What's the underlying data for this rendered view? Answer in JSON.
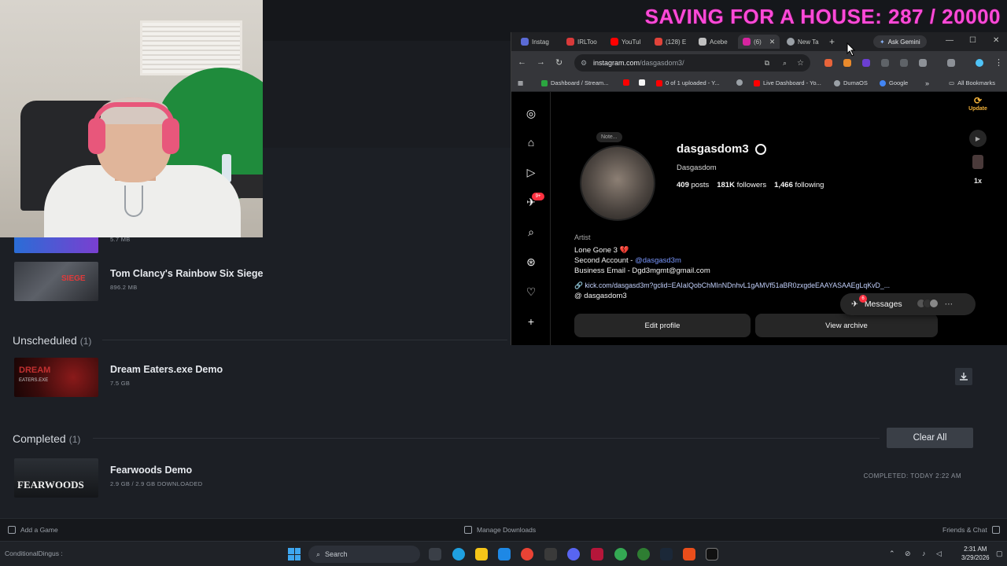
{
  "overlay": {
    "saving_text": "SAVING FOR A HOUSE: 287 / 20000"
  },
  "steam": {
    "games_top": [
      {
        "title": "",
        "size": "5.7 MB"
      },
      {
        "title": "Tom Clancy's Rainbow Six Siege",
        "size": "896.2 MB",
        "thumb_text": "SIEGE"
      }
    ],
    "unscheduled": {
      "label": "Unscheduled",
      "count": "(1)"
    },
    "unscheduled_game": {
      "title": "Dream Eaters.exe Demo",
      "size": "7.5 GB",
      "thumb_text": "DREAM",
      "thumb_sub": "EATERS.EXE"
    },
    "completed": {
      "label": "Completed",
      "count": "(1)"
    },
    "completed_game": {
      "title": "Fearwoods Demo",
      "size": "2.9 GB / 2.9 GB DOWNLOADED",
      "thumb_text": "FEARWOODS",
      "completed_at": "COMPLETED: TODAY 2:22 AM"
    },
    "clear_all": "Clear All",
    "footer": {
      "add_game": "Add a Game",
      "manage_downloads": "Manage Downloads",
      "friends_chat": "Friends & Chat"
    }
  },
  "chrome": {
    "tabs": [
      {
        "label": "Instag",
        "color": "#5b6bd6"
      },
      {
        "label": "IRLToo",
        "color": "#d93a3a"
      },
      {
        "label": "YouTul",
        "color": "#ff0000"
      },
      {
        "label": "(128) E",
        "color": "#e0433a"
      },
      {
        "label": "Acebe",
        "color": "#c0c0c0"
      },
      {
        "label": "(6)",
        "color": "#d6249f",
        "active": true
      },
      {
        "label": "New Ta",
        "color": "#9aa0a6"
      }
    ],
    "new_tab_symbol": "+",
    "ask_gemini": "Ask Gemini",
    "url_domain": "instagram.com",
    "url_path": "/dasgasdom3/",
    "bookmarks": [
      {
        "label": "Dashboard / Stream...",
        "color": "#2ba640"
      },
      {
        "label": "",
        "color": "#ff0000"
      },
      {
        "label": "",
        "color": "#f5f5f5"
      },
      {
        "label": "0 of 1 uploaded - Y...",
        "color": "#ff0000"
      },
      {
        "label": "",
        "color": "#9aa0a6"
      },
      {
        "label": "Live Dashboard - Yo...",
        "color": "#ff0000"
      },
      {
        "label": "DumaOS",
        "color": "#9aa0a6"
      },
      {
        "label": "Google",
        "color": "#4285f4"
      }
    ],
    "all_bookmarks": "All Bookmarks",
    "more_bookmarks": "»"
  },
  "instagram": {
    "note_text": "Note...",
    "username": "dasgasdom3",
    "full_name": "Dasgasdom",
    "posts_count": "409",
    "posts_label": "posts",
    "followers_count": "181K",
    "followers_label": "followers",
    "following_count": "1,466",
    "following_label": "following",
    "category": "Artist",
    "bio_line1": "Lone Gone 3 💔",
    "bio_line2_prefix": "Second Account - ",
    "bio_line2_mention": "@dasgasd3m",
    "bio_line3": "Business Email - Dgd3mgmt@gmail.com",
    "bio_link": "kick.com/dasgasd3m?gclid=EAIaIQobChMInNDnhvL1gAMVf51aBR0zxgdeEAAYASAAEgLqKvD_...",
    "threads_handle": "dasgasdom3",
    "edit_profile": "Edit profile",
    "view_archive": "View archive",
    "notif_badge": "9+",
    "messages_label": "Messages",
    "messages_badge": "6",
    "update_label": "Update",
    "speed_label": "1x"
  },
  "taskbar": {
    "left_text": "ConditionalDingus :",
    "search_placeholder": "Search",
    "time": "2:31 AM",
    "date": "3/29/2026",
    "apps": [
      "#e9c46a",
      "#3b82f6",
      "#f5c518",
      "#1e88e5",
      "#ea4335",
      "#e24d42",
      "#5865f2",
      "#e8344e",
      "#34a853",
      "#2e7d32",
      "#1b2838",
      "#e94e1b",
      "#444"
    ]
  }
}
